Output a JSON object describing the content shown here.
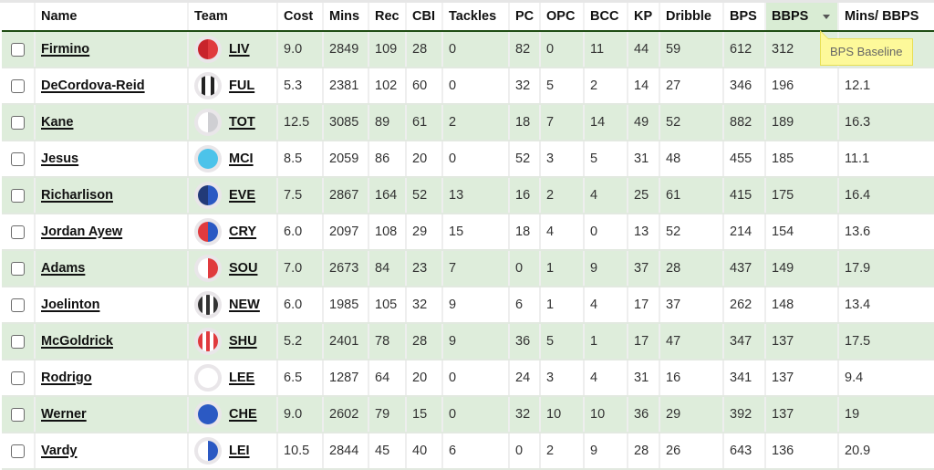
{
  "columns": [
    {
      "key": "select",
      "label": ""
    },
    {
      "key": "name",
      "label": "Name"
    },
    {
      "key": "team",
      "label": "Team"
    },
    {
      "key": "cost",
      "label": "Cost"
    },
    {
      "key": "mins",
      "label": "Mins"
    },
    {
      "key": "rec",
      "label": "Rec"
    },
    {
      "key": "cbi",
      "label": "CBI"
    },
    {
      "key": "tackles",
      "label": "Tackles"
    },
    {
      "key": "pc",
      "label": "PC"
    },
    {
      "key": "opc",
      "label": "OPC"
    },
    {
      "key": "bcc",
      "label": "BCC"
    },
    {
      "key": "kp",
      "label": "KP"
    },
    {
      "key": "dribble",
      "label": "Dribble"
    },
    {
      "key": "bps",
      "label": "BPS"
    },
    {
      "key": "bbps",
      "label": "BBPS",
      "sorted": "desc"
    },
    {
      "key": "mins_bbps",
      "label": "Mins/ BBPS"
    }
  ],
  "tooltip": {
    "text": "BPS Baseline",
    "column": "bbps"
  },
  "team_icons": {
    "LIV": {
      "icon": "liverpool-kit-icon",
      "colors": [
        "#c8242b",
        "#e03a3e"
      ]
    },
    "FUL": {
      "icon": "fulham-kit-icon",
      "colors": [
        "#222222",
        "#ffffff"
      ]
    },
    "TOT": {
      "icon": "tottenham-kit-icon",
      "colors": [
        "#ffffff",
        "#cfcfd3"
      ]
    },
    "MCI": {
      "icon": "man-city-kit-icon",
      "colors": [
        "#4cc3ea",
        "#4cc3ea"
      ]
    },
    "EVE": {
      "icon": "everton-kit-icon",
      "colors": [
        "#223a78",
        "#2b59c3"
      ]
    },
    "CRY": {
      "icon": "crystal-palace-kit-icon",
      "colors": [
        "#e03a3e",
        "#2b59c3"
      ]
    },
    "SOU": {
      "icon": "southampton-kit-icon",
      "colors": [
        "#ffffff",
        "#e03a3e"
      ]
    },
    "NEW": {
      "icon": "newcastle-kit-icon",
      "colors": [
        "#333333",
        "#ffffff"
      ]
    },
    "SHU": {
      "icon": "sheffield-utd-kit-icon",
      "colors": [
        "#e03a3e",
        "#ffffff"
      ]
    },
    "LEE": {
      "icon": "leeds-kit-icon",
      "colors": [
        "#ffffff",
        "#ffffff"
      ]
    },
    "CHE": {
      "icon": "chelsea-kit-icon",
      "colors": [
        "#2b59c3",
        "#2b59c3"
      ]
    },
    "LEI": {
      "icon": "leicester-kit-icon",
      "colors": [
        "#ffffff",
        "#2b59c3"
      ]
    }
  },
  "rows": [
    {
      "name": "Firmino",
      "team": "LIV",
      "cost": "9.0",
      "mins": "2849",
      "rec": "109",
      "cbi": "28",
      "tackles": "0",
      "pc": "82",
      "opc": "0",
      "bcc": "11",
      "kp": "44",
      "dribble": "59",
      "bps": "612",
      "bbps": "312",
      "mins_bbps": "",
      "checked": false
    },
    {
      "name": "DeCordova-Reid",
      "team": "FUL",
      "cost": "5.3",
      "mins": "2381",
      "rec": "102",
      "cbi": "60",
      "tackles": "0",
      "pc": "32",
      "opc": "5",
      "bcc": "2",
      "kp": "14",
      "dribble": "27",
      "bps": "346",
      "bbps": "196",
      "mins_bbps": "12.1",
      "checked": false
    },
    {
      "name": "Kane",
      "team": "TOT",
      "cost": "12.5",
      "mins": "3085",
      "rec": "89",
      "cbi": "61",
      "tackles": "2",
      "pc": "18",
      "opc": "7",
      "bcc": "14",
      "kp": "49",
      "dribble": "52",
      "bps": "882",
      "bbps": "189",
      "mins_bbps": "16.3",
      "checked": false
    },
    {
      "name": "Jesus",
      "team": "MCI",
      "cost": "8.5",
      "mins": "2059",
      "rec": "86",
      "cbi": "20",
      "tackles": "0",
      "pc": "52",
      "opc": "3",
      "bcc": "5",
      "kp": "31",
      "dribble": "48",
      "bps": "455",
      "bbps": "185",
      "mins_bbps": "11.1",
      "checked": false
    },
    {
      "name": "Richarlison",
      "team": "EVE",
      "cost": "7.5",
      "mins": "2867",
      "rec": "164",
      "cbi": "52",
      "tackles": "13",
      "pc": "16",
      "opc": "2",
      "bcc": "4",
      "kp": "25",
      "dribble": "61",
      "bps": "415",
      "bbps": "175",
      "mins_bbps": "16.4",
      "checked": false
    },
    {
      "name": "Jordan Ayew",
      "team": "CRY",
      "cost": "6.0",
      "mins": "2097",
      "rec": "108",
      "cbi": "29",
      "tackles": "15",
      "pc": "18",
      "opc": "4",
      "bcc": "0",
      "kp": "13",
      "dribble": "52",
      "bps": "214",
      "bbps": "154",
      "mins_bbps": "13.6",
      "checked": false
    },
    {
      "name": "Adams",
      "team": "SOU",
      "cost": "7.0",
      "mins": "2673",
      "rec": "84",
      "cbi": "23",
      "tackles": "7",
      "pc": "0",
      "opc": "1",
      "bcc": "9",
      "kp": "37",
      "dribble": "28",
      "bps": "437",
      "bbps": "149",
      "mins_bbps": "17.9",
      "checked": false
    },
    {
      "name": "Joelinton",
      "team": "NEW",
      "cost": "6.0",
      "mins": "1985",
      "rec": "105",
      "cbi": "32",
      "tackles": "9",
      "pc": "6",
      "opc": "1",
      "bcc": "4",
      "kp": "17",
      "dribble": "37",
      "bps": "262",
      "bbps": "148",
      "mins_bbps": "13.4",
      "checked": false
    },
    {
      "name": "McGoldrick",
      "team": "SHU",
      "cost": "5.2",
      "mins": "2401",
      "rec": "78",
      "cbi": "28",
      "tackles": "9",
      "pc": "36",
      "opc": "5",
      "bcc": "1",
      "kp": "17",
      "dribble": "47",
      "bps": "347",
      "bbps": "137",
      "mins_bbps": "17.5",
      "checked": false
    },
    {
      "name": "Rodrigo",
      "team": "LEE",
      "cost": "6.5",
      "mins": "1287",
      "rec": "64",
      "cbi": "20",
      "tackles": "0",
      "pc": "24",
      "opc": "3",
      "bcc": "4",
      "kp": "31",
      "dribble": "16",
      "bps": "341",
      "bbps": "137",
      "mins_bbps": "9.4",
      "checked": false
    },
    {
      "name": "Werner",
      "team": "CHE",
      "cost": "9.0",
      "mins": "2602",
      "rec": "79",
      "cbi": "15",
      "tackles": "0",
      "pc": "32",
      "opc": "10",
      "bcc": "10",
      "kp": "36",
      "dribble": "29",
      "bps": "392",
      "bbps": "137",
      "mins_bbps": "19",
      "checked": false
    },
    {
      "name": "Vardy",
      "team": "LEI",
      "cost": "10.5",
      "mins": "2844",
      "rec": "45",
      "cbi": "40",
      "tackles": "6",
      "pc": "0",
      "opc": "2",
      "bcc": "9",
      "kp": "28",
      "dribble": "26",
      "bps": "643",
      "bbps": "136",
      "mins_bbps": "20.9",
      "checked": false
    }
  ]
}
